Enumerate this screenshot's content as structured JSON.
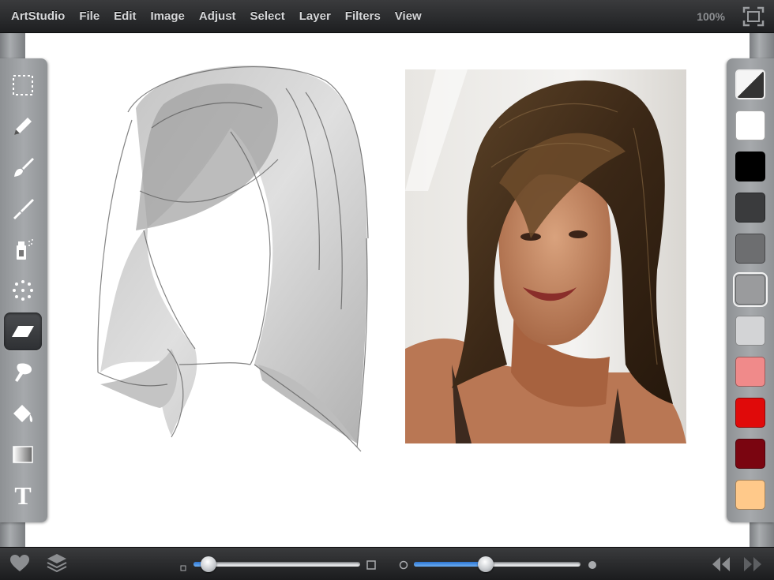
{
  "menu": {
    "app_name": "ArtStudio",
    "items": [
      "File",
      "Edit",
      "Image",
      "Adjust",
      "Select",
      "Layer",
      "Filters",
      "View"
    ],
    "zoom": "100%"
  },
  "tools": [
    {
      "name": "rectangle-select-icon"
    },
    {
      "name": "pencil-icon"
    },
    {
      "name": "brush-icon"
    },
    {
      "name": "smudge-brush-icon"
    },
    {
      "name": "spray-can-icon"
    },
    {
      "name": "scatter-brush-icon"
    },
    {
      "name": "eraser-icon",
      "active": true
    },
    {
      "name": "smudge-finger-icon"
    },
    {
      "name": "paint-bucket-icon"
    },
    {
      "name": "gradient-icon"
    },
    {
      "name": "text-tool-icon",
      "glyph": "T"
    }
  ],
  "palette": {
    "colors": [
      "#ffffff",
      "#000000",
      "#3a3b3d",
      "#6d6e70",
      "#9a9b9d",
      "#d3d4d6",
      "#f08a8a",
      "#e00a0a",
      "#7a0510",
      "#ffc98a"
    ],
    "selected_index": 4,
    "primary": "#f5f5f5",
    "secondary": "#333333"
  },
  "bottom": {
    "brush_size": 0.09,
    "brush_opacity": 0.43,
    "accent": "#3d8ce6"
  }
}
